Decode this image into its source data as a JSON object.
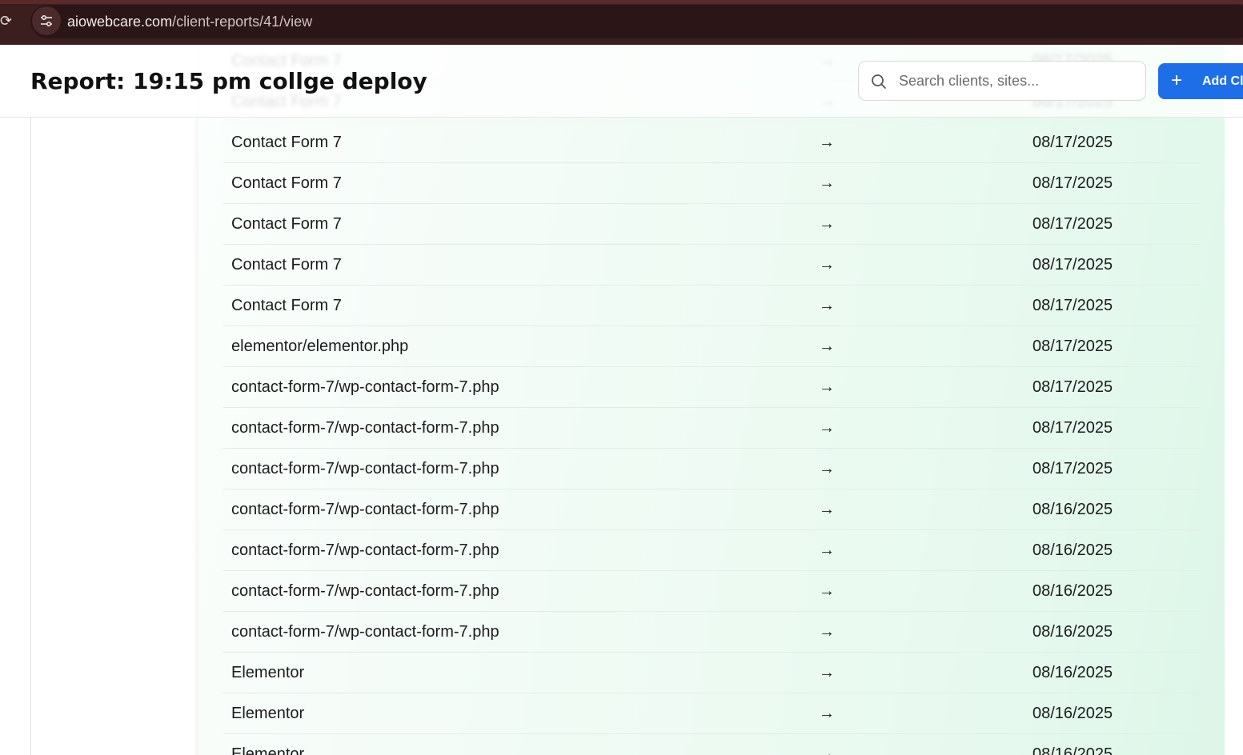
{
  "browser": {
    "url_domain": "aiowebcare.com",
    "url_path": "/client-reports/41/view"
  },
  "header": {
    "title": "Report: 19:15 pm collge deploy",
    "search_placeholder": "Search clients, sites...",
    "add_button_label": "Add Cli"
  },
  "table": {
    "rows": [
      {
        "name": "Contact Form 7",
        "arrow": "→",
        "date": "08/17/2025"
      },
      {
        "name": "Contact Form 7",
        "arrow": "→",
        "date": "08/17/2025"
      },
      {
        "name": "Contact Form 7",
        "arrow": "→",
        "date": "08/17/2025"
      },
      {
        "name": "Contact Form 7",
        "arrow": "→",
        "date": "08/17/2025"
      },
      {
        "name": "Contact Form 7",
        "arrow": "→",
        "date": "08/17/2025"
      },
      {
        "name": "Contact Form 7",
        "arrow": "→",
        "date": "08/17/2025"
      },
      {
        "name": "Contact Form 7",
        "arrow": "→",
        "date": "08/17/2025"
      },
      {
        "name": "elementor/elementor.php",
        "arrow": "→",
        "date": "08/17/2025"
      },
      {
        "name": "contact-form-7/wp-contact-form-7.php",
        "arrow": "→",
        "date": "08/17/2025"
      },
      {
        "name": "contact-form-7/wp-contact-form-7.php",
        "arrow": "→",
        "date": "08/17/2025"
      },
      {
        "name": "contact-form-7/wp-contact-form-7.php",
        "arrow": "→",
        "date": "08/17/2025"
      },
      {
        "name": "contact-form-7/wp-contact-form-7.php",
        "arrow": "→",
        "date": "08/16/2025"
      },
      {
        "name": "contact-form-7/wp-contact-form-7.php",
        "arrow": "→",
        "date": "08/16/2025"
      },
      {
        "name": "contact-form-7/wp-contact-form-7.php",
        "arrow": "→",
        "date": "08/16/2025"
      },
      {
        "name": "contact-form-7/wp-contact-form-7.php",
        "arrow": "→",
        "date": "08/16/2025"
      },
      {
        "name": "Elementor",
        "arrow": "→",
        "date": "08/16/2025"
      },
      {
        "name": "Elementor",
        "arrow": "→",
        "date": "08/16/2025"
      },
      {
        "name": "Elementor",
        "arrow": "→",
        "date": "08/16/2025"
      }
    ]
  },
  "colors": {
    "accent": "#1e6ee8",
    "browser_bar": "#3b1f1f"
  },
  "icons": {
    "reload": "reload-icon",
    "site_info": "tune-icon",
    "search": "search-icon",
    "add": "plus-icon"
  }
}
